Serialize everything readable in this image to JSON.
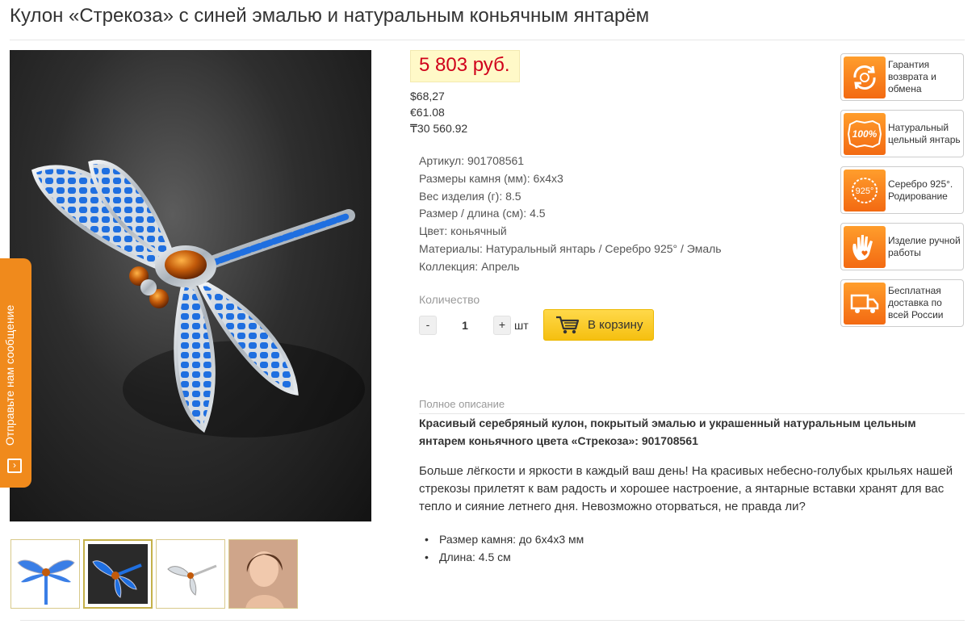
{
  "product": {
    "title": "Кулон «Стрекоза» с синей эмалью и натуральным коньячным янтарём"
  },
  "price": {
    "main": "5 803 руб.",
    "alternatives": [
      "$68,27",
      "€61.08",
      "₸30 560.92"
    ]
  },
  "properties": [
    {
      "label": "Артикул:",
      "value": "901708561"
    },
    {
      "label": "Размеры камня (мм):",
      "value": "6х4х3"
    },
    {
      "label": "Вес изделия (г):",
      "value": "8.5"
    },
    {
      "label": "Размер / длина (см):",
      "value": "4.5"
    },
    {
      "label": "Цвет:",
      "value": "коньячный"
    },
    {
      "label": "Материалы:",
      "value": "Натуральный янтарь / Серебро 925° / Эмаль"
    },
    {
      "label": "Коллекция:",
      "value": "Апрель"
    }
  ],
  "quantity": {
    "label": "Количество",
    "minus": "-",
    "value": "1",
    "plus": "+",
    "unit": "шт"
  },
  "cart": {
    "label": "В корзину"
  },
  "feedback_tab": {
    "label": "Отправьте нам сообщение",
    "icon_glyph": "›"
  },
  "badges": [
    {
      "icon": "return-exchange-icon",
      "text": "Гарантия возврата и обмена"
    },
    {
      "icon": "hundred-percent-icon",
      "icon_text": "100%",
      "text": "Натуральный цельный янтарь"
    },
    {
      "icon": "silver-925-icon",
      "icon_text": "925°",
      "text": "Серебро 925°. Родирование"
    },
    {
      "icon": "handmade-icon",
      "text": "Изделие ручной работы"
    },
    {
      "icon": "delivery-truck-icon",
      "text": "Бесплатная доставка по всей России"
    }
  ],
  "description": {
    "label": "Полное описание",
    "title": "Красивый серебряный кулон, покрытый эмалью и украшенный натуральным цельным янтарем коньячного цвета «Стрекоза»: 901708561",
    "body": "Больше лёгкости и яркости в каждый ваш день! На красивых небесно-голубых крыльях нашей стрекозы прилетят к вам радость и хорошее настроение, а янтарные вставки хранят для вас тепло и сияние летнего дня. Невозможно оторваться, не правда ли?",
    "bullets": [
      "Размер камня: до 6х4х3 мм",
      "Длина: 4.5 см"
    ]
  },
  "colors": {
    "price_red": "#d0021b",
    "price_bg": "#fff9c8",
    "accent_orange": "#f08a1c",
    "cart_yellow": "#f5bf10",
    "enamel_blue": "#1f6fe0"
  }
}
